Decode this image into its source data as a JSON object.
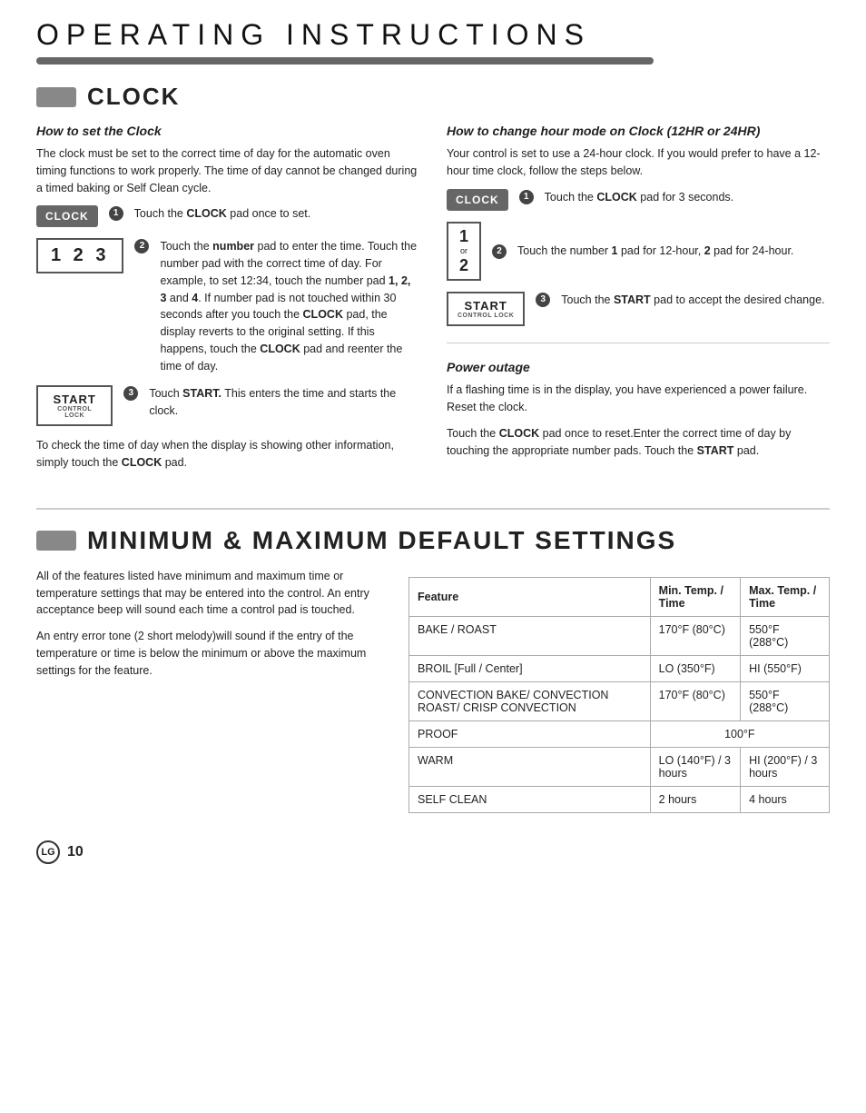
{
  "page": {
    "title": "OPERATING INSTRUCTIONS",
    "page_number": "10",
    "logo_text": "LG"
  },
  "clock_section": {
    "bar_label": "",
    "title": "CLOCK",
    "how_to_set": {
      "heading": "How to set the Clock",
      "intro": "The clock must be set to the correct time of day for the automatic oven timing functions to work properly. The time of day cannot be changed during a timed baking or Self Clean cycle.",
      "steps": [
        {
          "step_num": "1",
          "button_label": "CLOCK",
          "instruction": "Touch the CLOCK pad once to set.",
          "bold_word": "CLOCK"
        },
        {
          "step_num": "2",
          "display_text": "1  2  3",
          "instruction": "Touch the number pad to enter the time. Touch the number pad with the correct time of day. For example, to set 12:34, touch the number pad 1, 2, 3 and 4. If number pad is not touched within 30 seconds after you touch the CLOCK pad, the display reverts to the original setting. If this happens, touch the CLOCK pad and reenter the time of day.",
          "bold_words": [
            "number",
            "1, 2, 3",
            "4",
            "CLOCK",
            "CLOCK"
          ]
        },
        {
          "step_num": "3",
          "button_main": "START",
          "button_sub": "CONTROL LOCK",
          "instruction": "Touch START. This enters the time and starts the clock.",
          "bold_word": "START."
        }
      ],
      "footer_text": "To check the time of day when the display is showing other information, simply touch the CLOCK pad.",
      "footer_bold": "CLOCK"
    },
    "how_to_change": {
      "heading": "How to change hour mode on Clock (12HR or 24HR)",
      "intro": "Your control is set to use a 24-hour clock. If you would prefer to have a 12-hour time clock, follow the steps below.",
      "steps": [
        {
          "step_num": "1",
          "button_label": "CLOCK",
          "instruction": "Touch the CLOCK pad for 3 seconds.",
          "bold_word": "CLOCK"
        },
        {
          "step_num": "2",
          "display_or": "or",
          "display_nums": [
            "1",
            "2"
          ],
          "instruction": "Touch the number 1 pad for 12-hour, 2 pad for 24-hour.",
          "bold_words": [
            "1",
            "2"
          ]
        },
        {
          "step_num": "3",
          "button_main": "START",
          "button_sub": "CONTROL LOCK",
          "instruction": "Touch the START pad to accept the desired change.",
          "bold_word": "START"
        }
      ]
    },
    "power_outage": {
      "heading": "Power outage",
      "para1": "If a flashing time is in the display, you have experienced a power failure. Reset the clock.",
      "para2": "Touch the CLOCK pad once to reset.Enter the correct time of day by touching the appropriate number pads. Touch the START pad.",
      "bold_words_p2": [
        "CLOCK",
        "START"
      ]
    }
  },
  "min_max_section": {
    "title": "MINIMUM & MAXIMUM DEFAULT SETTINGS",
    "intro1": "All of the features listed have minimum and maximum time or temperature settings that may be entered into the control. An entry acceptance beep will sound each time a control pad is touched.",
    "intro2": "An entry error tone (2 short melody)will sound if the entry of the temperature or time is below the minimum or above the maximum settings for the feature.",
    "table": {
      "headers": [
        "Feature",
        "Min. Temp. / Time",
        "Max. Temp. / Time"
      ],
      "rows": [
        {
          "feature": "BAKE / ROAST",
          "min": "170°F (80°C)",
          "max": "550°F (288°C)"
        },
        {
          "feature": "BROIL [Full / Center]",
          "min": "LO (350°F)",
          "max": "HI (550°F)"
        },
        {
          "feature": "CONVECTION BAKE/ CONVECTION ROAST/ CRISP CONVECTION",
          "min": "170°F (80°C)",
          "max": "550°F (288°C)"
        },
        {
          "feature": "PROOF",
          "min": "100°F",
          "max": "",
          "colspan": true
        },
        {
          "feature": "WARM",
          "min": "LO (140°F) / 3 hours",
          "max": "HI (200°F) / 3 hours"
        },
        {
          "feature": "SELF CLEAN",
          "min": "2 hours",
          "max": "4 hours"
        }
      ]
    }
  }
}
